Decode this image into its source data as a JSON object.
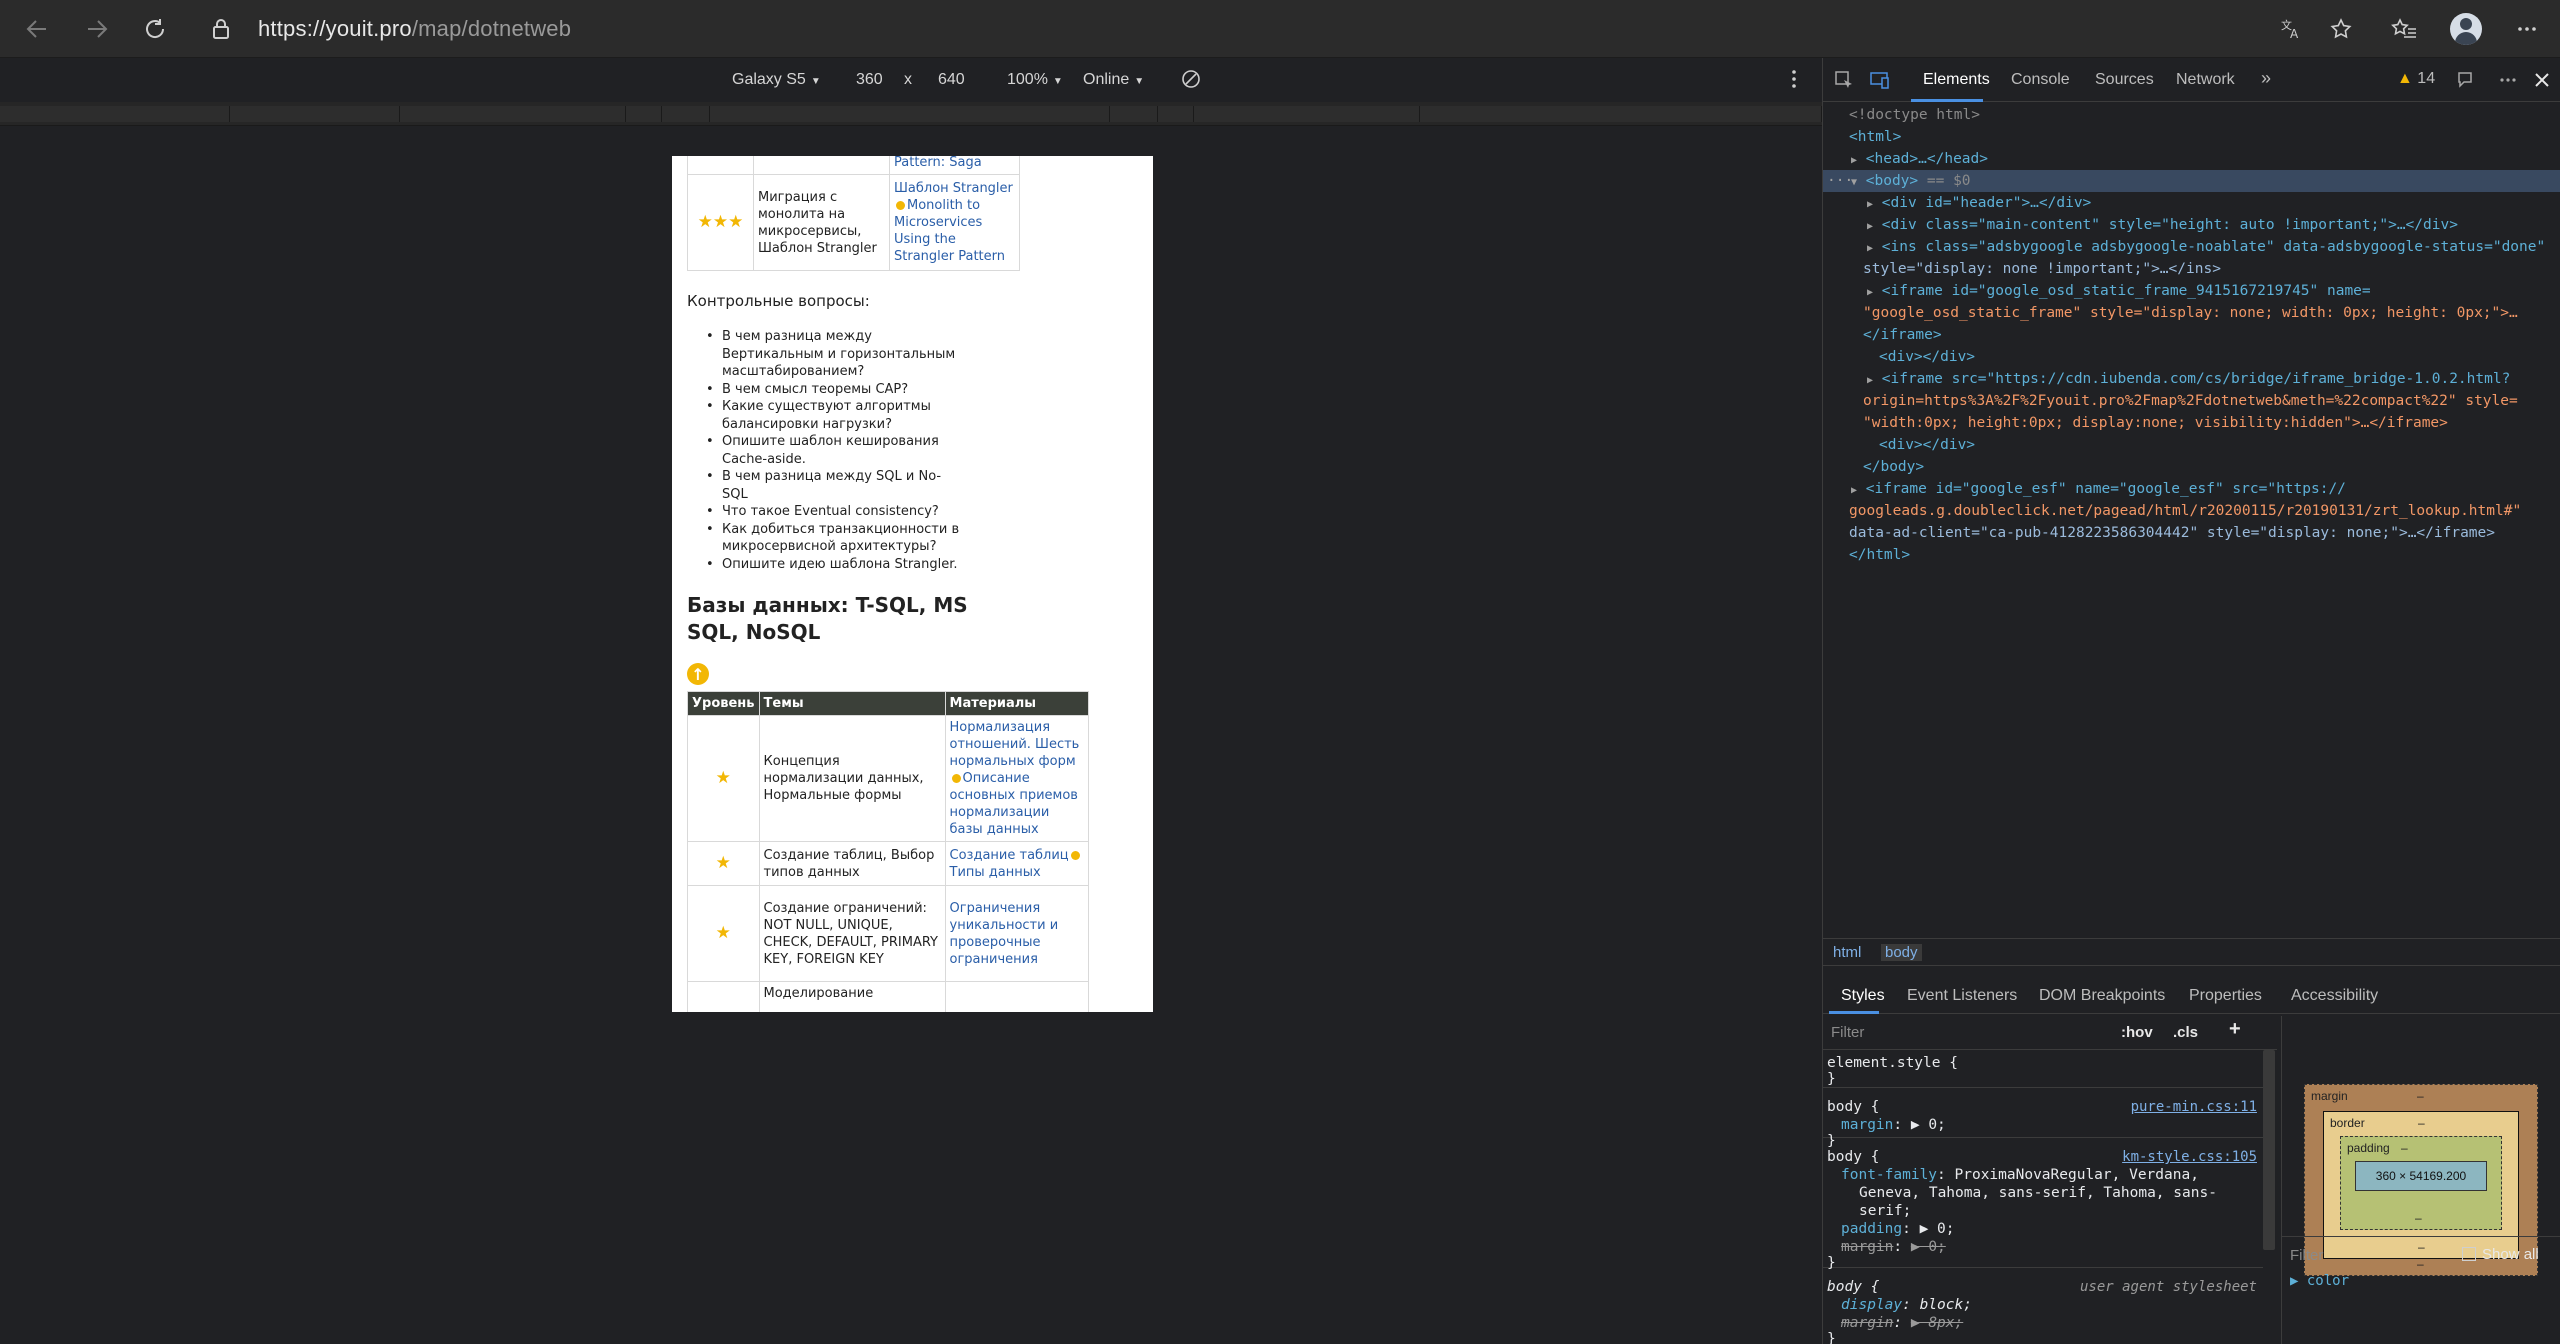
{
  "browser": {
    "url_host": "https://youit.pro",
    "url_path": "/map/dotnetweb"
  },
  "device_toolbar": {
    "device": "Galaxy S5",
    "width": "360",
    "times": "x",
    "height": "640",
    "zoom": "100%",
    "network": "Online"
  },
  "page": {
    "table1": {
      "row0_link": "Pattern: Saga",
      "row1_topic": "Миграция с монолита на микросервисы, Шаблон Strangler",
      "row1_link1": "Шаблон Strangler",
      "row1_link2": "Monolith to Microservices Using the Strangler Pattern",
      "row1_stars": "★★★"
    },
    "questions_title": "Контрольные вопросы:",
    "questions": [
      "В чем разница между Вертикальным и горизонтальным масштабированием?",
      "В чем смысл теоремы CAP?",
      "Какие существуют алгоритмы балансировки нагрузки?",
      "Опишите шаблон кеширования Cache-aside.",
      "В чем разница между SQL и No-SQL",
      "Что такое Eventual consistency?",
      "Как добиться транзакционности в микросервисной архитектуры?",
      "Опишите идею шаблона Strangler."
    ],
    "section_title": "Базы данных: T-SQL, MS SQL, NoSQL",
    "up_icon": "↑",
    "table2": {
      "headers": [
        "Уровень",
        "Темы",
        "Материалы"
      ],
      "rows": [
        {
          "stars": "★",
          "topic": "Концепция нормализации данных, Нормальные формы",
          "link1": "Нормализация отношений. Шесть нормальных форм",
          "link2": "Описание основных приемов нормализации базы данных"
        },
        {
          "stars": "★",
          "topic": "Создание таблиц, Выбор типов данных",
          "link1": "Создание таблиц",
          "link2": "Типы данных"
        },
        {
          "stars": "★",
          "topic": "Создание ограничений: NOT NULL, UNIQUE, CHECK, DEFAULT, PRIMARY KEY, FOREIGN KEY",
          "link1": "Ограничения уникальности и проверочные ограничения",
          "link2": ""
        },
        {
          "stars": "",
          "topic": "Моделирование",
          "link1": "",
          "link2": ""
        }
      ]
    }
  },
  "devtools": {
    "tabs": [
      "Elements",
      "Console",
      "Sources",
      "Network"
    ],
    "more_tabs": "»",
    "warnings": "14",
    "dom_lines": {
      "l1": "<!doctype html>",
      "l2": "<html>",
      "l3": "<head>…</head>",
      "l4_tag": "<body>",
      "l4_eq": " == $0",
      "l5": "<div id=\"header\">…</div>",
      "l6": "<div class=\"main-content\" style=\"height: auto !important;\">…</div>",
      "l7": "<ins class=\"adsbygoogle adsbygoogle-noablate\" data-adsbygoogle-status=\"done\"",
      "l8": "style=\"display: none !important;\">…</ins>",
      "l9": "<iframe id=\"google_osd_static_frame_9415167219745\" name=",
      "l10": "\"google_osd_static_frame\" style=\"display: none; width: 0px; height: 0px;\">…",
      "l11": "</iframe>",
      "l12": "<div></div>",
      "l13": "<iframe src=\"https://cdn.iubenda.com/cs/bridge/iframe_bridge-1.0.2.html?",
      "l14": "origin=https%3A%2F%2Fyouit.pro%2Fmap%2Fdotnetweb&meth=%22compact%22\" style=",
      "l15": "\"width:0px; height:0px; display:none; visibility:hidden\">…</iframe>",
      "l16": "<div></div>",
      "l17": "</body>",
      "l18": "<iframe id=\"google_esf\" name=\"google_esf\" src=\"https://",
      "l19": "googleads.g.doubleclick.net/pagead/html/r20200115/r20190131/zrt_lookup.html#\"",
      "l20": "data-ad-client=\"ca-pub-4128223586304442\" style=\"display: none;\">…</iframe>",
      "l21": "</html>"
    },
    "breadcrumbs": [
      "html",
      "body"
    ],
    "sub_tabs": [
      "Styles",
      "Event Listeners",
      "DOM Breakpoints",
      "Properties",
      "Accessibility"
    ],
    "styles": {
      "filter_placeholder": "Filter",
      "hov": ":hov",
      "cls": ".cls",
      "plus": "+",
      "element_style": "element.style {",
      "close": "}",
      "rule1_sel": "body {",
      "rule1_src": "pure-min.css:11",
      "rule1_prop": "margin",
      "rule1_val": "▶ 0;",
      "rule2_sel": "body {",
      "rule2_src": "km-style.css:105",
      "rule2_prop": "font-family",
      "rule2_val1": "ProximaNovaRegular, Verdana,",
      "rule2_val2": "Geneva, Tahoma, sans-serif, Tahoma, sans-",
      "rule2_val3": "serif;",
      "rule2_prop2": "padding",
      "rule2_val4": "▶ 0;",
      "rule2_prop3": "margin",
      "rule2_val5": "▶ 0;",
      "rule3_sel": "body {",
      "rule3_src": "user agent stylesheet",
      "rule3_prop": "display",
      "rule3_val": "block;",
      "rule3_prop2": "margin",
      "rule3_val2": "▶ 8px;"
    },
    "box_model": {
      "margin": "margin",
      "border": "border",
      "padding": "padding",
      "content": "360 × 54169.200",
      "dash": "–"
    },
    "computed": {
      "filter_placeholder": "Filter",
      "show_all": "Show all",
      "first_prop": "▶ color"
    }
  }
}
